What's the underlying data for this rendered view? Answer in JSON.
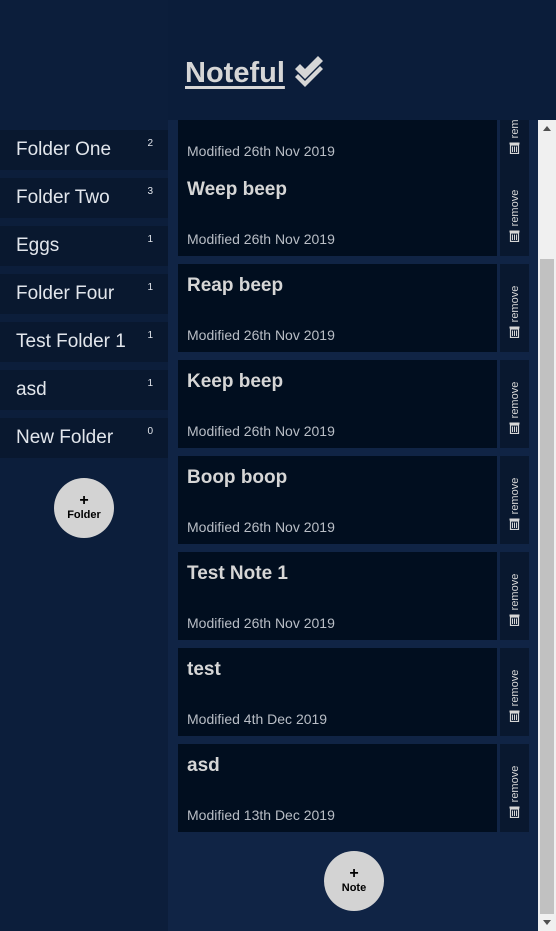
{
  "app": {
    "title": "Noteful",
    "logo_icon": "double-check-icon"
  },
  "folders": [
    {
      "name": "Folder One",
      "count": "2"
    },
    {
      "name": "Folder Two",
      "count": "3"
    },
    {
      "name": "Eggs",
      "count": "1"
    },
    {
      "name": "Folder Four",
      "count": "1"
    },
    {
      "name": "Test Folder 1",
      "count": "1"
    },
    {
      "name": "asd",
      "count": "1"
    },
    {
      "name": "New Folder",
      "count": "0"
    }
  ],
  "add_folder": {
    "plus": "+",
    "label": "Folder"
  },
  "notes": [
    {
      "title": "",
      "modified": "Modified 26th Nov 2019",
      "remove_label": "remove"
    },
    {
      "title": "Weep beep",
      "modified": "Modified 26th Nov 2019",
      "remove_label": "remove"
    },
    {
      "title": "Reap beep",
      "modified": "Modified 26th Nov 2019",
      "remove_label": "remove"
    },
    {
      "title": "Keep beep",
      "modified": "Modified 26th Nov 2019",
      "remove_label": "remove"
    },
    {
      "title": "Boop boop",
      "modified": "Modified 26th Nov 2019",
      "remove_label": "remove"
    },
    {
      "title": "Test Note 1",
      "modified": "Modified 26th Nov 2019",
      "remove_label": "remove"
    },
    {
      "title": "test",
      "modified": "Modified 4th Dec 2019",
      "remove_label": "remove"
    },
    {
      "title": "asd",
      "modified": "Modified 13th Dec 2019",
      "remove_label": "remove"
    }
  ],
  "add_note": {
    "plus": "+",
    "label": "Note"
  },
  "colors": {
    "background": "#0a1a33",
    "panel": "#010e1f",
    "button": "#d3d3d3"
  }
}
